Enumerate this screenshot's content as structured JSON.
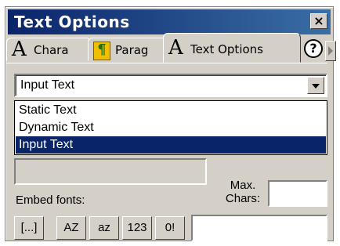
{
  "window": {
    "title": "Text Options",
    "close_glyph": "×"
  },
  "tabs": [
    {
      "icon": "text-character-icon",
      "glyph": "A",
      "label": "Chara"
    },
    {
      "icon": "paragraph-icon",
      "glyph": "¶",
      "label": "Parag"
    },
    {
      "icon": "text-options-icon",
      "glyph": "A",
      "label": "Text Options",
      "active": true
    }
  ],
  "help": {
    "glyph": "?"
  },
  "text_type": {
    "selected": "Input Text",
    "options": [
      "Static Text",
      "Dynamic Text",
      "Input Text"
    ],
    "highlighted": "Input Text"
  },
  "max_chars": {
    "label_line1": "Max.",
    "label_line2": "Chars:",
    "value": ""
  },
  "embed": {
    "label": "Embed fonts:",
    "buttons": [
      {
        "name": "embed-outlines-button",
        "label": "[...]"
      },
      {
        "name": "embed-uppercase-button",
        "label": "AZ"
      },
      {
        "name": "embed-lowercase-button",
        "label": "az"
      },
      {
        "name": "embed-numbers-button",
        "label": "123"
      },
      {
        "name": "embed-punctuation-button",
        "label": "0!"
      }
    ],
    "chars_value": ""
  },
  "colors": {
    "title_bar": "#0a246a",
    "panel": "#d4d0c8",
    "selection": "#0a246a"
  }
}
